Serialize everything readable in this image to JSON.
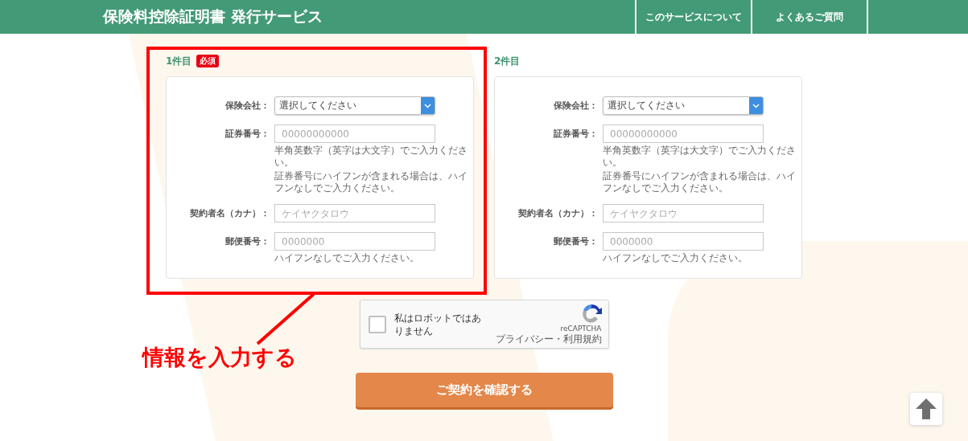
{
  "header": {
    "title": "保険料控除証明書 発行サービス",
    "nav": [
      {
        "label": "このサービスについて"
      },
      {
        "label": "よくあるご質問"
      }
    ]
  },
  "forms": [
    {
      "heading": "1件目",
      "badge": "必須",
      "fields": [
        {
          "kind": "select",
          "label": "保険会社：",
          "value": "選択してください"
        },
        {
          "kind": "input",
          "label": "証券番号：",
          "placeholder": "00000000000",
          "hints": [
            "半角英数字（英字は大文字）でご入力ください。",
            "証券番号にハイフンが含まれる場合は、ハイフンなしでご入力ください。"
          ]
        },
        {
          "kind": "input",
          "label": "契約者名（カナ）：",
          "placeholder": "ケイヤクタロウ"
        },
        {
          "kind": "input",
          "label": "郵便番号：",
          "placeholder": "0000000",
          "hints": [
            "ハイフンなしでご入力ください。"
          ]
        }
      ]
    },
    {
      "heading": "2件目",
      "fields": [
        {
          "kind": "select",
          "label": "保険会社：",
          "value": "選択してください"
        },
        {
          "kind": "input",
          "label": "証券番号：",
          "placeholder": "00000000000",
          "hints": [
            "半角英数字（英字は大文字）でご入力ください。",
            "証券番号にハイフンが含まれる場合は、ハイフンなしでご入力ください。"
          ]
        },
        {
          "kind": "input",
          "label": "契約者名（カナ）：",
          "placeholder": "ケイヤクタロウ"
        },
        {
          "kind": "input",
          "label": "郵便番号：",
          "placeholder": "0000000",
          "hints": [
            "ハイフンなしでご入力ください。"
          ]
        }
      ]
    }
  ],
  "captcha": {
    "label": "私はロボットではありません",
    "checked": false,
    "brand": "reCAPTCHA",
    "links": "プライバシー・利用規約"
  },
  "submit": "ご契約を確認する",
  "annotation": {
    "text": "情報を入力する"
  }
}
